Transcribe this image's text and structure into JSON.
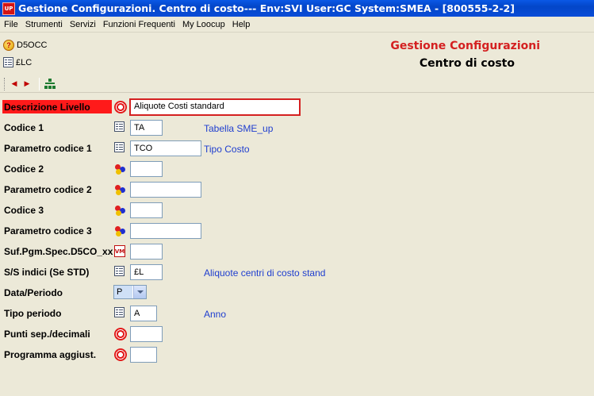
{
  "window": {
    "app_badge": "UP",
    "title": "Gestione Configurazioni. Centro di costo--- Env:SVI User:GC System:SMEA - [800555-2-2]"
  },
  "menu": [
    "File",
    "Strumenti",
    "Servizi",
    "Funzioni Frequenti",
    "My Loocup",
    "Help"
  ],
  "header": {
    "code1": "D5OCC",
    "code2": "£LC",
    "title": "Gestione Configurazioni",
    "subtitle": "Centro di costo"
  },
  "fields": [
    {
      "label": "Descrizione Livello",
      "icon": "target-icon",
      "value": "Aliquote Costi standard",
      "desc": ""
    },
    {
      "label": "Codice 1",
      "icon": "grid-icon",
      "value": "TA",
      "desc": "Tabella SME_up"
    },
    {
      "label": "Parametro codice 1",
      "icon": "grid-icon",
      "value": "TCO",
      "desc": "Tipo Costo"
    },
    {
      "label": "Codice 2",
      "icon": "balls-icon",
      "value": "",
      "desc": ""
    },
    {
      "label": "Parametro codice 2",
      "icon": "balls-icon",
      "value": "",
      "desc": ""
    },
    {
      "label": "Codice 3",
      "icon": "balls-icon",
      "value": "",
      "desc": ""
    },
    {
      "label": "Parametro codice 3",
      "icon": "balls-icon",
      "value": "",
      "desc": ""
    },
    {
      "label": "Suf.Pgm.Spec.D5CO_xx",
      "icon": "vm-icon",
      "icon_text": "VM",
      "value": "",
      "desc": ""
    },
    {
      "label": "S/S indici (Se STD)",
      "icon": "grid-icon",
      "value": "£L",
      "desc": "Aliquote centri di costo stand"
    },
    {
      "label": "Data/Periodo",
      "icon": "",
      "value": "P",
      "desc": ""
    },
    {
      "label": "Tipo periodo",
      "icon": "grid-icon",
      "value": "A",
      "desc": "Anno"
    },
    {
      "label": "Punti sep./decimali",
      "icon": "target-icon",
      "value": "",
      "desc": ""
    },
    {
      "label": "Programma aggiust.",
      "icon": "target-icon",
      "value": "",
      "desc": ""
    }
  ],
  "colors": {
    "accent_red": "#d42020",
    "link_blue": "#1f3ecf",
    "titlebar": "#0a58e6"
  }
}
